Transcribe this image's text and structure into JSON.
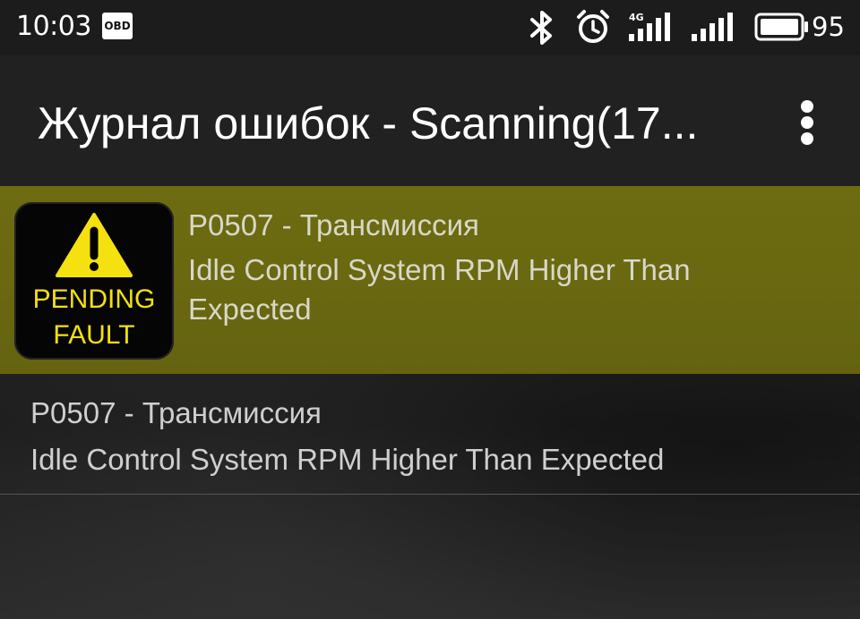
{
  "status_bar": {
    "time": "10:03",
    "obd_label": "OBD",
    "network_label": "4G",
    "battery_level": "95"
  },
  "app_bar": {
    "title": "Журнал ошибок - Scanning(17..."
  },
  "faults": [
    {
      "badge_line_1": "PENDING",
      "badge_line_2": "FAULT",
      "code": "P0507 - Трансмиссия",
      "description": "Idle Control System RPM Higher Than Expected"
    },
    {
      "code": "P0507 - Трансмиссия",
      "description": "Idle Control System RPM Higher Than Expected"
    }
  ],
  "colors": {
    "highlight_row": "#6b6911",
    "badge_text": "#f2e010",
    "warning_triangle": "#f5e10f",
    "app_bar": "#212121"
  }
}
